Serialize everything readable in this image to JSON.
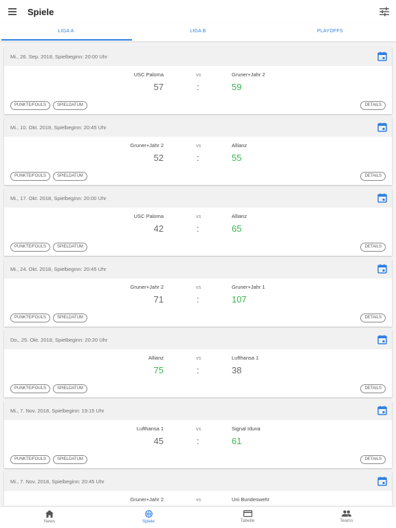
{
  "app": {
    "title": "Spiele"
  },
  "tabs": [
    {
      "label": "LIGA A",
      "active": true
    },
    {
      "label": "LIGA B",
      "active": false
    },
    {
      "label": "PLAYOFFS",
      "active": false
    }
  ],
  "labels": {
    "vs": "vs",
    "colon": ":",
    "punkte": "PUNKTE/FOULS",
    "spieldatum": "SPIELDATUM",
    "details": "DETAILS"
  },
  "games": [
    {
      "date": "Mi., 26. Sep. 2018, Spielbeginn: 20:00 Uhr",
      "home": "USC Paloma",
      "away": "Gruner+Jahr 2",
      "home_score": "57",
      "away_score": "59"
    },
    {
      "date": "Mi., 10. Okt. 2018, Spielbeginn: 20:45 Uhr",
      "home": "Gruner+Jahr 2",
      "away": "Allianz",
      "home_score": "52",
      "away_score": "55"
    },
    {
      "date": "Mi., 17. Okt. 2018, Spielbeginn: 20:00 Uhr",
      "home": "USC Paloma",
      "away": "Allianz",
      "home_score": "42",
      "away_score": "65"
    },
    {
      "date": "Mi., 24. Okt. 2018, Spielbeginn: 20:45 Uhr",
      "home": "Gruner+Jahr 2",
      "away": "Gruner+Jahr 1",
      "home_score": "71",
      "away_score": "107"
    },
    {
      "date": "Do., 25. Okt. 2018, Spielbeginn: 20:20 Uhr",
      "home": "Allianz",
      "away": "Lufthansa 1",
      "home_score": "75",
      "away_score": "38"
    },
    {
      "date": "Mi., 7. Nov. 2018, Spielbeginn: 19:15 Uhr",
      "home": "Lufthansa 1",
      "away": "Signal Iduna",
      "home_score": "45",
      "away_score": "61"
    },
    {
      "date": "Mi., 7. Nov. 2018, Spielbeginn: 20:45 Uhr",
      "home": "Gruner+Jahr 2",
      "away": "Uni Bundeswehr",
      "home_score": "",
      "away_score": ""
    }
  ],
  "colors": {
    "accent": "#2f7fe0",
    "winner": "#39b54a",
    "loser": "#666666"
  },
  "icons": {
    "menu": "menu-icon",
    "filter": "filter-sliders-icon",
    "calendar": "calendar-icon"
  },
  "bottom_nav": [
    {
      "label": "News",
      "icon": "home-icon",
      "active": false
    },
    {
      "label": "Spiele",
      "icon": "basketball-icon",
      "active": true
    },
    {
      "label": "Tabelle",
      "icon": "table-card-icon",
      "active": false
    },
    {
      "label": "Teams",
      "icon": "people-icon",
      "active": false
    }
  ]
}
